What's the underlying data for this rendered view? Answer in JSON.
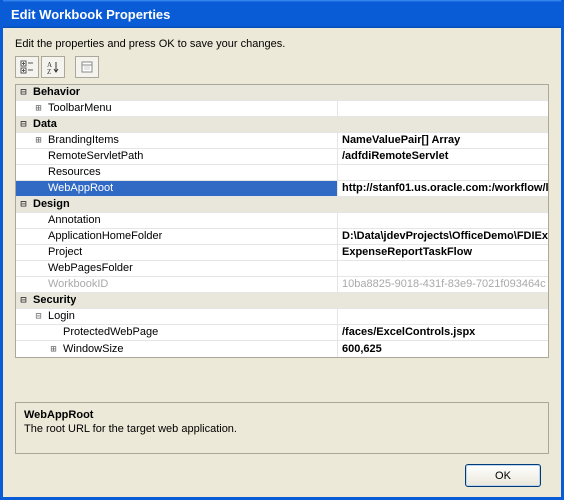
{
  "window": {
    "title": "Edit Workbook Properties"
  },
  "hint": "Edit the properties and press OK to save your changes.",
  "toolbar": {
    "categorized_tip": "Categorized",
    "alphabetical_tip": "Alphabetical",
    "pages_tip": "Property Pages"
  },
  "grid": {
    "behavior": {
      "label": "Behavior",
      "toolbarMenu": {
        "label": "ToolbarMenu",
        "value": ""
      }
    },
    "data": {
      "label": "Data",
      "brandingItems": {
        "label": "BrandingItems",
        "value": "NameValuePair[] Array"
      },
      "remoteServletPath": {
        "label": "RemoteServletPath",
        "value": "/adfdiRemoteServlet"
      },
      "resources": {
        "label": "Resources",
        "value": ""
      },
      "webAppRoot": {
        "label": "WebAppRoot",
        "value": "http://stanf01.us.oracle.com:/workflow/l"
      }
    },
    "design": {
      "label": "Design",
      "annotation": {
        "label": "Annotation",
        "value": ""
      },
      "applicationHomeFolder": {
        "label": "ApplicationHomeFolder",
        "value": "D:\\Data\\jdevProjects\\OfficeDemo\\FDIEx"
      },
      "project": {
        "label": "Project",
        "value": "ExpenseReportTaskFlow"
      },
      "webPagesFolder": {
        "label": "WebPagesFolder",
        "value": ""
      },
      "workbookID": {
        "label": "WorkbookID",
        "value": "10ba8825-9018-431f-83e9-7021f093464c"
      }
    },
    "security": {
      "label": "Security",
      "login": {
        "label": "Login",
        "protectedWebPage": {
          "label": "ProtectedWebPage",
          "value": "/faces/ExcelControls.jspx"
        },
        "windowSize": {
          "label": "WindowSize",
          "value": "600,625"
        }
      }
    }
  },
  "description": {
    "title": "WebAppRoot",
    "text": "The root URL for the target web application."
  },
  "buttons": {
    "ok": "OK"
  }
}
